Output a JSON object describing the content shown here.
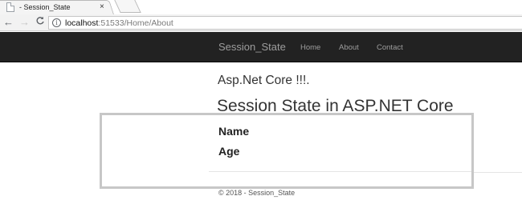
{
  "browser": {
    "tab": {
      "title": "- Session_State",
      "close_glyph": "×",
      "favicon": "page-icon"
    },
    "toolbar": {
      "back_glyph": "←",
      "forward_glyph": "→",
      "reload_glyph": "C",
      "info_glyph": "i",
      "url_host": "localhost",
      "url_rest": ":51533/Home/About"
    }
  },
  "navbar": {
    "brand": "Session_State",
    "links": [
      "Home",
      "About",
      "Contact"
    ],
    "background": "#222222",
    "link_color": "#9d9d9d"
  },
  "main": {
    "subheading": "Asp.Net Core !!!.",
    "heading": "Session State in ASP.NET Core",
    "fields": [
      "Name",
      "Age"
    ]
  },
  "footer": {
    "text": "© 2018 - Session_State"
  }
}
